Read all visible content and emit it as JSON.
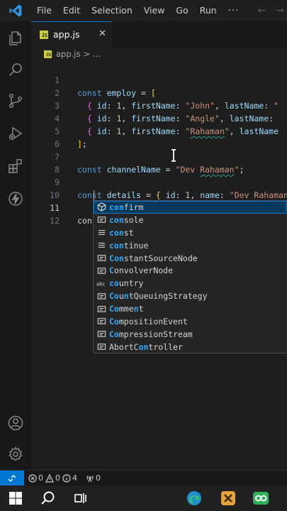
{
  "menu": {
    "items": [
      "File",
      "Edit",
      "Selection",
      "View",
      "Go",
      "Run"
    ],
    "more": "···"
  },
  "icons": {
    "app": "vscode-logo-icon",
    "activity": [
      "explorer-icon",
      "search-icon",
      "source-control-icon",
      "run-debug-icon",
      "extensions-icon",
      "lightning-icon"
    ],
    "activity_bottom": [
      "account-icon",
      "settings-gear-icon"
    ]
  },
  "tab": {
    "label": "app.js",
    "close": "✕",
    "badge": "JS"
  },
  "breadcrumb": {
    "file": "app.js",
    "sep": ">",
    "trail": "..."
  },
  "editor": {
    "line_numbers": [
      "1",
      "2",
      "3",
      "4",
      "5",
      "6",
      "7",
      "8",
      "9",
      "10",
      "11",
      "12"
    ],
    "active_line": "11",
    "typed_text": "con"
  },
  "suggestions": [
    {
      "match": "con",
      "rest": "firm",
      "kind": "method",
      "selected": true
    },
    {
      "match": "con",
      "rest": "sole",
      "kind": "variable"
    },
    {
      "match": "con",
      "rest": "st",
      "kind": "keyword"
    },
    {
      "match": "con",
      "rest": "tinue",
      "kind": "keyword"
    },
    {
      "pre": "",
      "parts": [
        [
          "C",
          true
        ],
        [
          "o",
          true
        ],
        [
          "n",
          true
        ],
        [
          "stantSourceNode",
          false
        ]
      ],
      "kind": "variable"
    },
    {
      "parts": [
        [
          "C",
          true
        ],
        [
          "o",
          false
        ],
        [
          "nvolverNode",
          false
        ]
      ],
      "kind": "variable"
    },
    {
      "parts": [
        [
          "co",
          true
        ],
        [
          "untry",
          false
        ]
      ],
      "kind": "text"
    },
    {
      "parts": [
        [
          "Co",
          true
        ],
        [
          "u",
          false
        ],
        [
          "n",
          true
        ],
        [
          "tQueuingStrategy",
          false
        ]
      ],
      "kind": "variable"
    },
    {
      "parts": [
        [
          "Co",
          true
        ],
        [
          "mme",
          false
        ],
        [
          "n",
          true
        ],
        [
          "t",
          false
        ]
      ],
      "kind": "variable"
    },
    {
      "parts": [
        [
          "Co",
          true
        ],
        [
          "mpositionEvent",
          false
        ]
      ],
      "kind": "variable"
    },
    {
      "parts": [
        [
          "Co",
          true
        ],
        [
          "mpressionStream",
          false
        ]
      ],
      "kind": "variable"
    },
    {
      "parts": [
        [
          "AbortC",
          false
        ],
        [
          "o",
          true
        ],
        [
          "n",
          true
        ],
        [
          "troller",
          false
        ]
      ],
      "kind": "variable"
    }
  ],
  "status": {
    "errors": "0",
    "warnings": "0",
    "info": "4",
    "ports": "0"
  },
  "colors": {
    "accent": "#0078d4",
    "highlight": "#2aaaff",
    "keyword": "#569cd6",
    "string": "#ce9178"
  }
}
